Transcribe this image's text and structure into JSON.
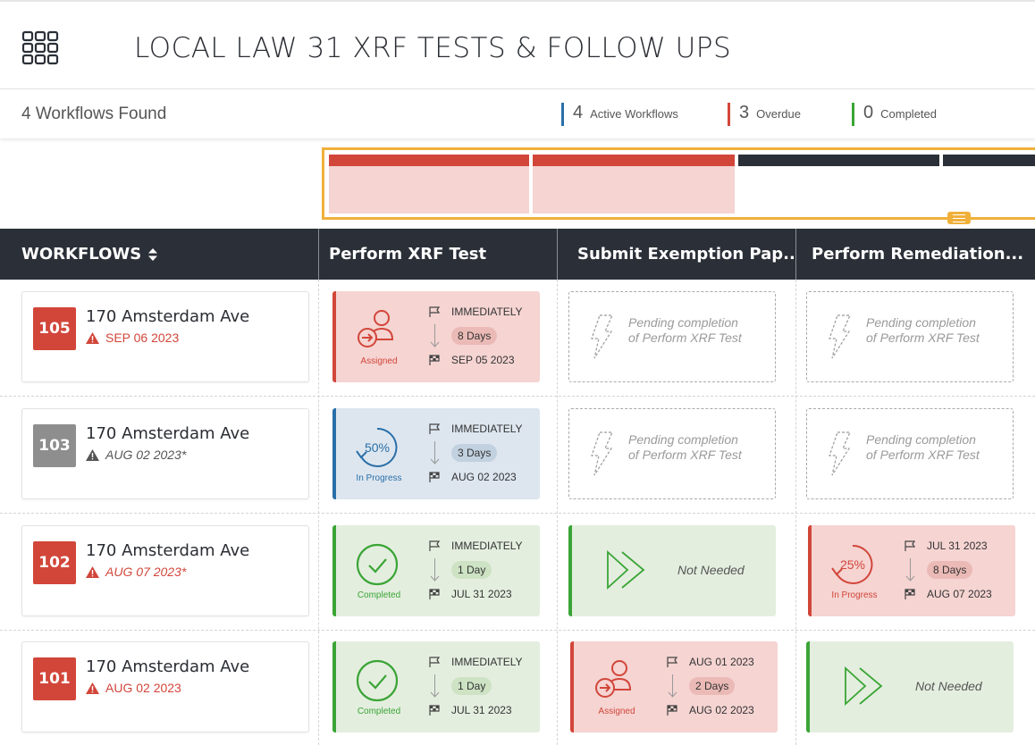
{
  "header": {
    "title": "LOCAL LAW 31 XRF TESTS & FOLLOW UPS",
    "apps_icon": "apps-grid-icon"
  },
  "summary": {
    "found": "4 Workflows Found",
    "stats": [
      {
        "num": "4",
        "label": "Active Workflows",
        "color": "#2a6fa8"
      },
      {
        "num": "3",
        "label": "Overdue",
        "color": "#d2463a"
      },
      {
        "num": "0",
        "label": "Completed",
        "color": "#3aa536"
      }
    ]
  },
  "overview": {
    "segments": [
      {
        "bar": "#d2463a",
        "fill": "#f5d4d2"
      },
      {
        "bar": "#d2463a",
        "fill": "#f5d4d2"
      },
      {
        "bar": "#2b3038",
        "fill": "#ffffff"
      },
      {
        "bar": "#2b3038",
        "fill": "#ffffff"
      }
    ]
  },
  "columns": {
    "workflows": "WORKFLOWS",
    "c1": "Perform XRF Test",
    "c2": "Submit Exemption Pap...",
    "c3": "Perform Remediation..."
  },
  "pending_text": {
    "line1": "Pending completion",
    "line2": "of Perform XRF Test"
  },
  "not_needed": "Not Needed",
  "rows": [
    {
      "id": "105",
      "id_color": "#d2463a",
      "address": "170 Amsterdam Ave",
      "due": "SEP 06 2023",
      "due_color": "#d2463a",
      "due_italic": false,
      "c1": {
        "kind": "assigned",
        "status": "Assigned",
        "start": "IMMEDIATELY",
        "dur": "8 Days",
        "end": "SEP 05 2023",
        "bg": "#f5d4d2",
        "accent": "#d2463a",
        "pill": "#ebbab6"
      },
      "c2": {
        "kind": "pending"
      },
      "c3": {
        "kind": "pending"
      }
    },
    {
      "id": "103",
      "id_color": "#8e8e8e",
      "address": "170 Amsterdam Ave",
      "due": "AUG 02 2023*",
      "due_color": "#555555",
      "due_italic": true,
      "c1": {
        "kind": "progress",
        "pct": "50%",
        "status": "In Progress",
        "start": "IMMEDIATELY",
        "dur": "3 Days",
        "end": "AUG 02 2023",
        "bg": "#dde6ef",
        "accent": "#2a6fa8",
        "pill": "#c2d1df",
        "ring": "#2a6fa8"
      },
      "c2": {
        "kind": "pending"
      },
      "c3": {
        "kind": "pending"
      }
    },
    {
      "id": "102",
      "id_color": "#d2463a",
      "address": "170 Amsterdam Ave",
      "due": "AUG 07 2023*",
      "due_color": "#d2463a",
      "due_italic": true,
      "c1": {
        "kind": "completed",
        "status": "Completed",
        "start": "IMMEDIATELY",
        "dur": "1 Day",
        "end": "JUL 31 2023",
        "bg": "#e4eedf",
        "accent": "#3aa536",
        "pill": "#cde3c4"
      },
      "c2": {
        "kind": "notneeded"
      },
      "c3": {
        "kind": "progress",
        "pct": "25%",
        "status": "In Progress",
        "start": "JUL 31 2023",
        "dur": "8 Days",
        "end": "AUG 07 2023",
        "bg": "#f5d4d2",
        "accent": "#d2463a",
        "pill": "#ebbab6",
        "ring": "#d2463a"
      }
    },
    {
      "id": "101",
      "id_color": "#d2463a",
      "address": "170 Amsterdam Ave",
      "due": "AUG 02 2023",
      "due_color": "#d2463a",
      "due_italic": false,
      "c1": {
        "kind": "completed",
        "status": "Completed",
        "start": "IMMEDIATELY",
        "dur": "1 Day",
        "end": "JUL 31 2023",
        "bg": "#e4eedf",
        "accent": "#3aa536",
        "pill": "#cde3c4"
      },
      "c2": {
        "kind": "assigned",
        "status": "Assigned",
        "start": "AUG 01 2023",
        "dur": "2 Days",
        "end": "AUG 02 2023",
        "bg": "#f5d4d2",
        "accent": "#d2463a",
        "pill": "#ebbab6"
      },
      "c3": {
        "kind": "notneeded"
      }
    }
  ]
}
